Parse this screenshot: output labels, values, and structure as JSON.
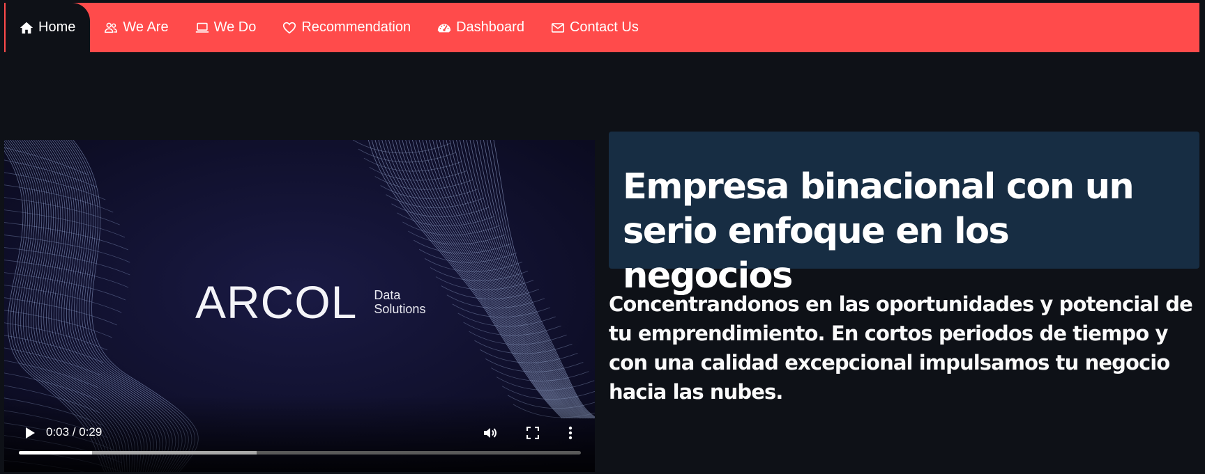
{
  "nav": {
    "accent": "#ff4b4b",
    "items": [
      {
        "label": "Home",
        "icon": "house-icon",
        "active": true
      },
      {
        "label": "We Are",
        "icon": "people-icon",
        "active": false
      },
      {
        "label": "We Do",
        "icon": "laptop-icon",
        "active": false
      },
      {
        "label": "Recommendation",
        "icon": "heart-icon",
        "active": false
      },
      {
        "label": "Dashboard",
        "icon": "speedometer-icon",
        "active": false
      },
      {
        "label": "Contact Us",
        "icon": "envelope-icon",
        "active": false
      }
    ]
  },
  "video": {
    "brand_name": "ARCOL",
    "brand_sub_line1": "Data",
    "brand_sub_line2": "Solutions",
    "time": "0:03 / 0:29",
    "played_fraction": 0.13,
    "buffered_fraction": 0.423
  },
  "hero": {
    "title": "Empresa binacional con un serio enfoque en los negocios",
    "description": "Concentrandonos en las oportunidades y potencial de tu emprendimiento. En cortos periodos de tiempo y con una calidad excepcional impulsamos tu negocio hacia las nubes."
  }
}
